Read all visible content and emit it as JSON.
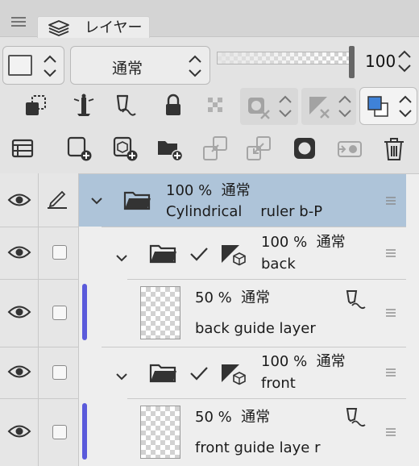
{
  "panel": {
    "tab_label": "レイヤー"
  },
  "blend_row": {
    "blend_mode": "通常",
    "opacity_value": "100",
    "opacity_fraction": 1.0
  },
  "toolbar_row1": {
    "icons": [
      "clip-to-layer-below-icon",
      "reference-layer-icon",
      "draft-layer-icon",
      "lock-icon",
      "lock-transparent-pixels-icon",
      "mask-toggle-icon",
      "ruler-visibility-icon",
      "layer-color-icon"
    ]
  },
  "toolbar_row2": {
    "icons": [
      "layer-property-icon",
      "new-raster-layer-icon",
      "new-vector-layer-icon",
      "new-folder-icon",
      "transfer-down-icon",
      "merge-down-icon",
      "layer-mask-icon",
      "ruler-to-layer-icon",
      "delete-layer-icon"
    ]
  },
  "colors": {
    "selected_row": "#aec4d9",
    "layer_color_bar": "#5a5adb",
    "layer_color_fill": "#3f82d8"
  },
  "layers": [
    {
      "line1": "100 %  通常",
      "line2": "Cylindrical    ruler b-P",
      "type": "folder",
      "selected": true
    },
    {
      "line1": "100 %  通常",
      "line2": "back",
      "type": "folder",
      "selected": false
    },
    {
      "line1": "50 %  通常",
      "line2": "back guide layer",
      "type": "raster",
      "selected": false
    },
    {
      "line1": "100 %  通常",
      "line2": "front",
      "type": "folder",
      "selected": false
    },
    {
      "line1": "50 %  通常",
      "line2": "front guide laye r",
      "type": "raster",
      "selected": false
    }
  ]
}
